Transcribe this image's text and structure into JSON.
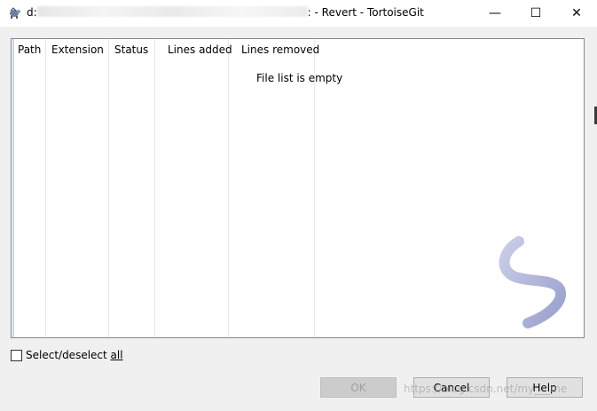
{
  "titlebar": {
    "prefix": "d:",
    "suffix": ": - Revert - TortoiseGit",
    "minimize_glyph": "—",
    "maximize_glyph": "☐",
    "close_glyph": "✕"
  },
  "list": {
    "columns": [
      "Path",
      "Extension",
      "Status",
      "Lines added",
      "Lines removed"
    ],
    "empty_message": "File list is empty"
  },
  "select_all": {
    "label_prefix": "Select/deselect ",
    "label_underlined": "all",
    "checked": false
  },
  "buttons": {
    "ok": "OK",
    "cancel": "Cancel",
    "help": "Help"
  },
  "watermark": "https://blog.csdn.net/my___me"
}
